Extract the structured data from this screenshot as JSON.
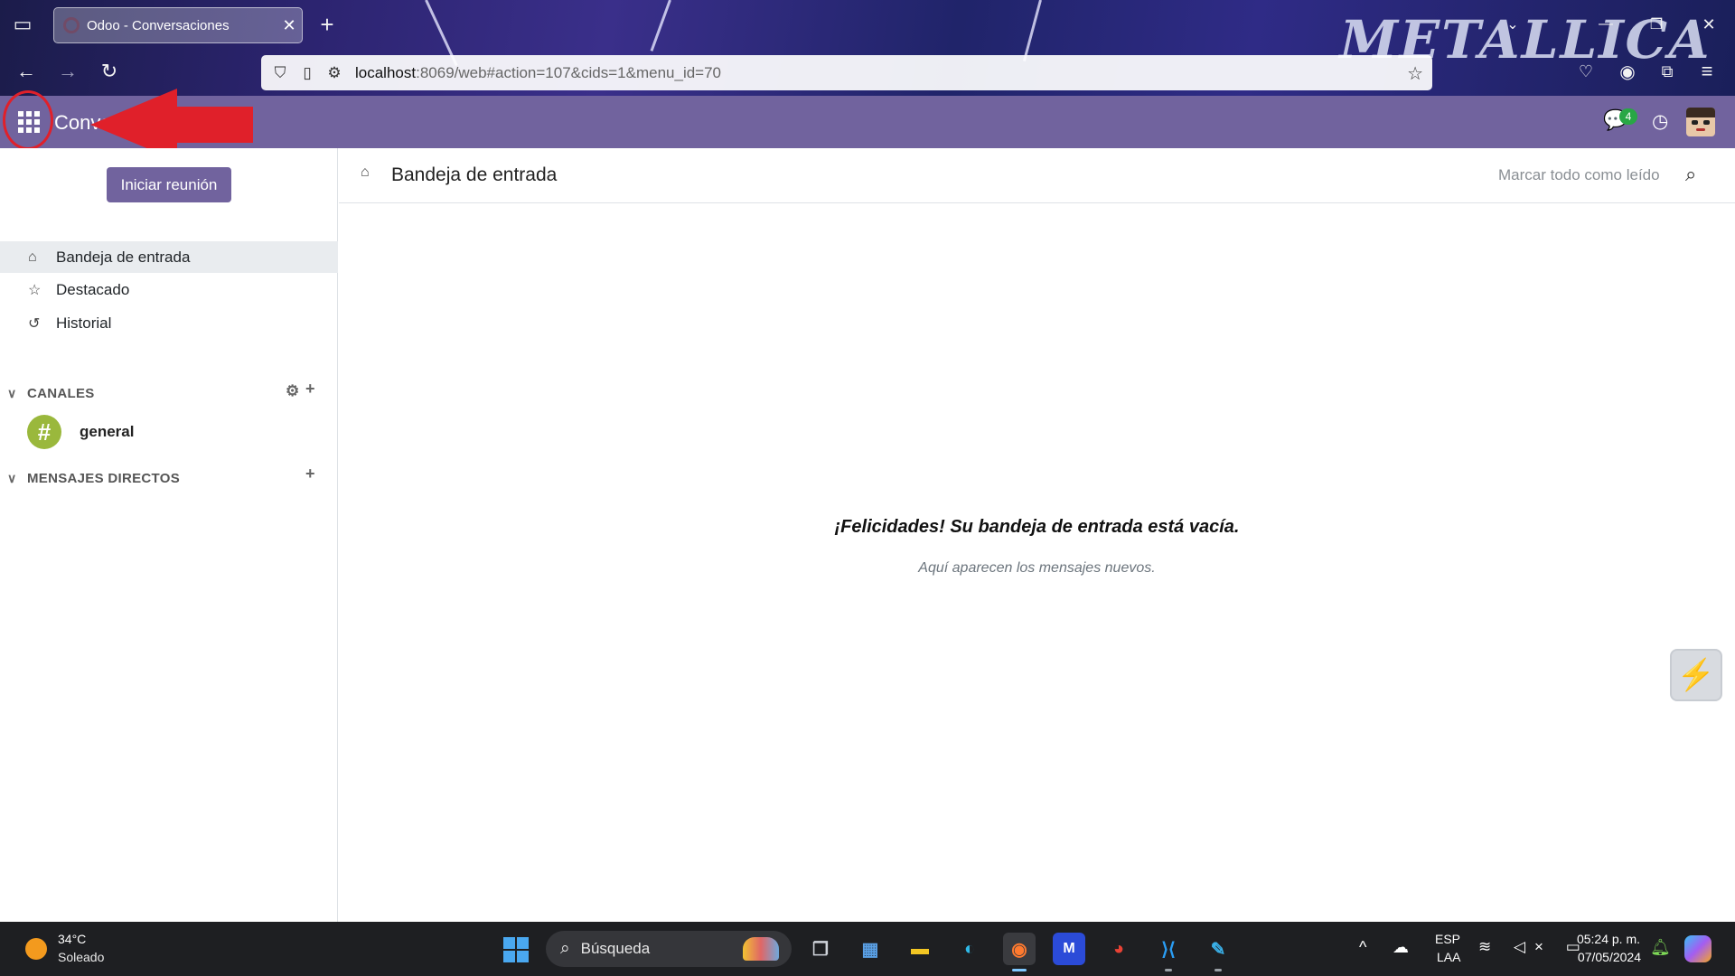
{
  "browser": {
    "tab_title": "Odoo - Conversaciones",
    "tab_close": "✕",
    "new_tab": "+",
    "url_host": "localhost",
    "url_rest": ":8069/web#action=107&cids=1&menu_id=70",
    "window_controls": {
      "minimize": "—",
      "restore": "❐",
      "close": "✕"
    }
  },
  "app": {
    "name": "Conve",
    "notification_count": "4"
  },
  "sidebar": {
    "start_meeting": "Iniciar reunión",
    "mailboxes": [
      {
        "label": "Bandeja de entrada",
        "icon": "inbox-icon",
        "active": true
      },
      {
        "label": "Destacado",
        "icon": "star-icon",
        "active": false
      },
      {
        "label": "Historial",
        "icon": "history-icon",
        "active": false
      }
    ],
    "channels_header": "CANALES",
    "channels": [
      {
        "label": "general",
        "symbol": "#"
      }
    ],
    "direct_messages_header": "MENSAJES DIRECTOS"
  },
  "main": {
    "title": "Bandeja de entrada",
    "mark_all_read": "Marcar todo como leído",
    "empty_title": "¡Felicidades! Su bandeja de entrada está vacía.",
    "empty_subtitle": "Aquí aparecen los mensajes nuevos."
  },
  "taskbar": {
    "weather_temp": "34°C",
    "weather_desc": "Soleado",
    "search_placeholder": "Búsqueda",
    "language_top": "ESP",
    "language_bottom": "LAA",
    "time": "05:24 p. m.",
    "date": "07/05/2024"
  },
  "colors": {
    "odoo_navbar": "#71639e",
    "annotation_red": "#e0202a",
    "channel_avatar": "#9ab83c",
    "badge_green": "#28a745"
  }
}
